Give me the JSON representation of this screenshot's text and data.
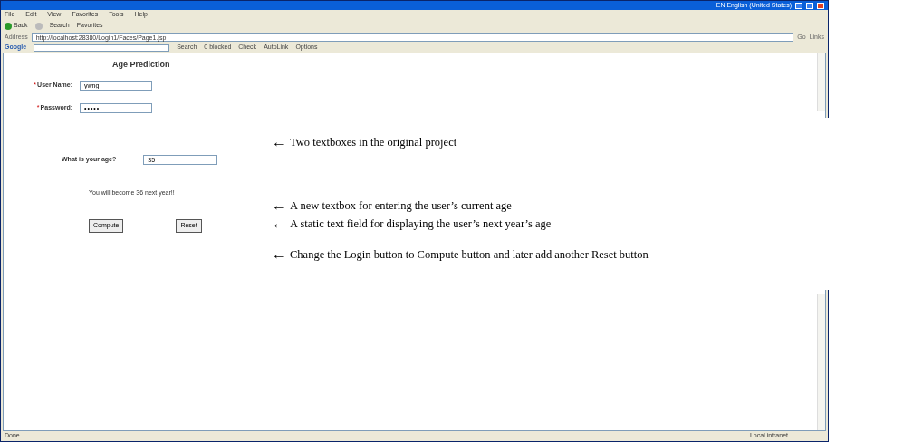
{
  "window": {
    "language": "EN English (United States)"
  },
  "menu": [
    "File",
    "Edit",
    "View",
    "Favorites",
    "Tools",
    "Help"
  ],
  "toolbar": {
    "back": "Back",
    "search": "Search",
    "favorites": "Favorites"
  },
  "address_bar": {
    "label": "Address",
    "url": "http://localhost:28380/Login1/Faces/Page1.jsp",
    "go": "Go",
    "links": "Links"
  },
  "google_bar": {
    "logo": "Google",
    "search": "Search",
    "blocked": "0 blocked",
    "check": "Check",
    "autolink": "AutoLink",
    "options": "Options"
  },
  "page": {
    "title": "Age Prediction",
    "required_mark": "*",
    "fields": [
      {
        "label": "User Name:",
        "value": "ywng",
        "required": true,
        "kind": "text"
      },
      {
        "label": "Password:",
        "value": "•••••",
        "required": true,
        "kind": "password"
      }
    ],
    "age_question": "What is your age?",
    "age_value": "35",
    "result": "You will become 36 next year!!",
    "buttons": [
      "Compute",
      "Reset"
    ]
  },
  "status_bar": {
    "status": "Done",
    "zone": "Local intranet"
  },
  "annotations": [
    "Two textboxes in the original project",
    "A new textbox for entering the user’s current age",
    "A static text field for displaying the user’s next year’s age",
    "Change the Login button to Compute button and later add another Reset button"
  ],
  "arrow": "←"
}
